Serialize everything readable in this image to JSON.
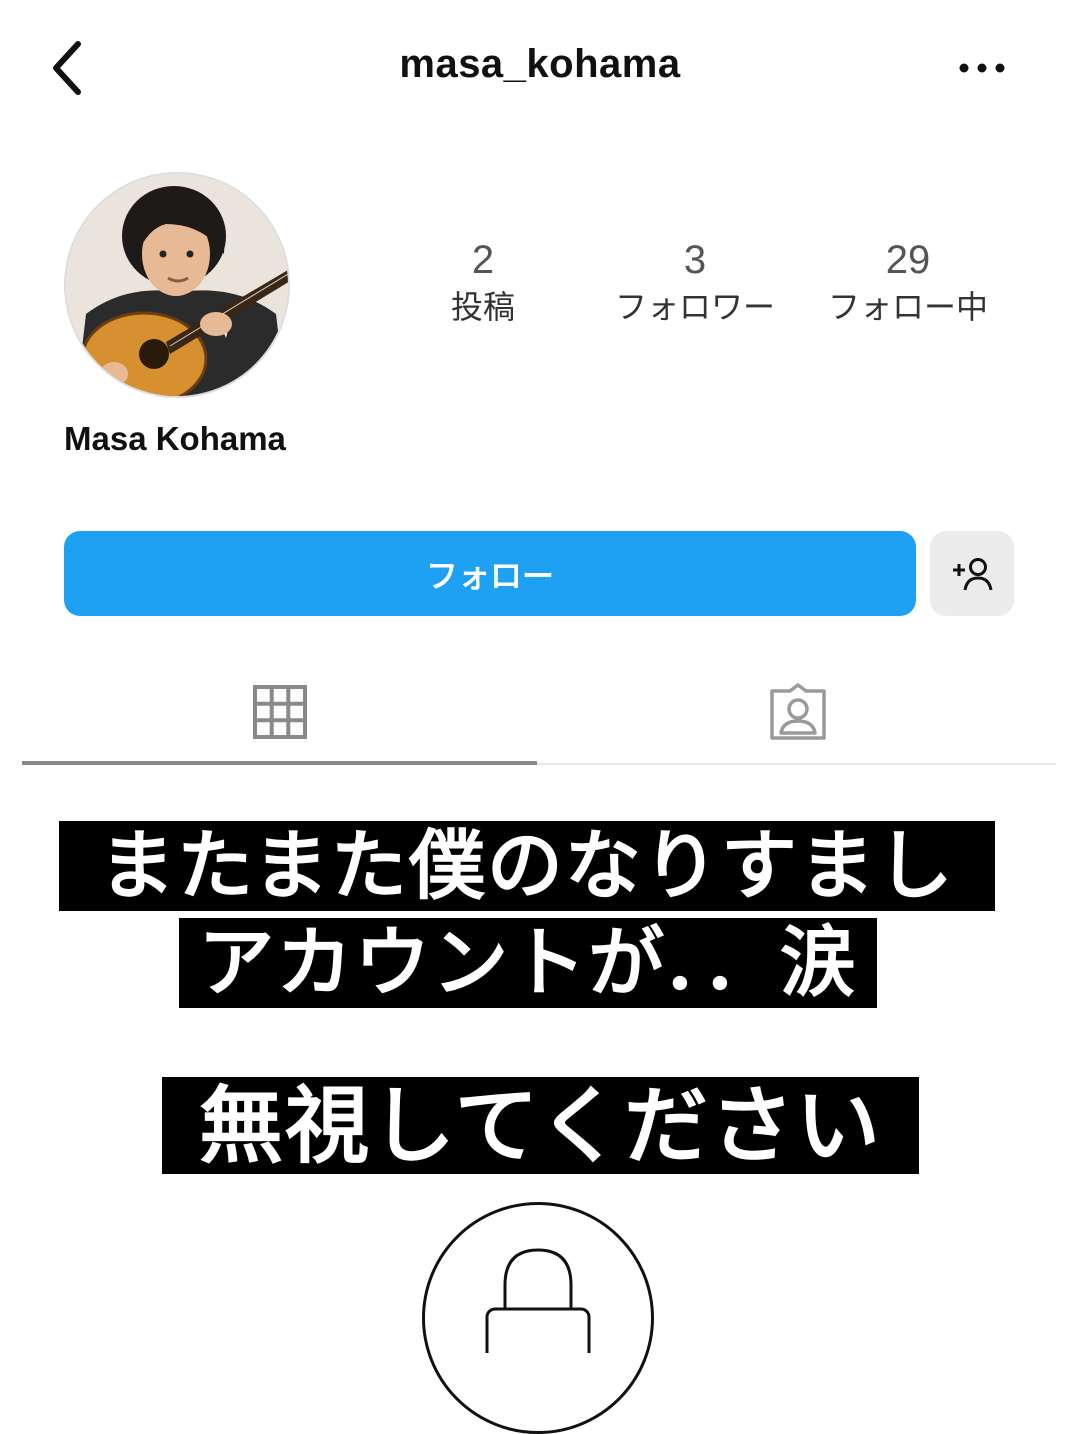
{
  "header": {
    "username": "masa_kohama",
    "back_icon": "chevron-left-icon",
    "more_icon": "more-horizontal-icon"
  },
  "profile": {
    "display_name": "Masa Kohama",
    "avatar_icon": "profile-photo-guitarist"
  },
  "stats": {
    "posts": {
      "count": "2",
      "label": "投稿"
    },
    "followers": {
      "count": "3",
      "label": "フォロワー"
    },
    "following": {
      "count": "29",
      "label": "フォロー中"
    }
  },
  "actions": {
    "follow_label": "フォロー",
    "suggest_icon": "add-person-icon",
    "follow_color": "#1ea1f2"
  },
  "tabs": [
    {
      "name": "posts-grid",
      "icon": "grid-icon",
      "active": true
    },
    {
      "name": "tagged",
      "icon": "tagged-person-icon",
      "active": false
    }
  ],
  "overlay": {
    "line1": "またまた僕のなりすまし",
    "line2": "アカウントが．．涙",
    "line3": "無視してください"
  },
  "private_icon": "lock-icon"
}
